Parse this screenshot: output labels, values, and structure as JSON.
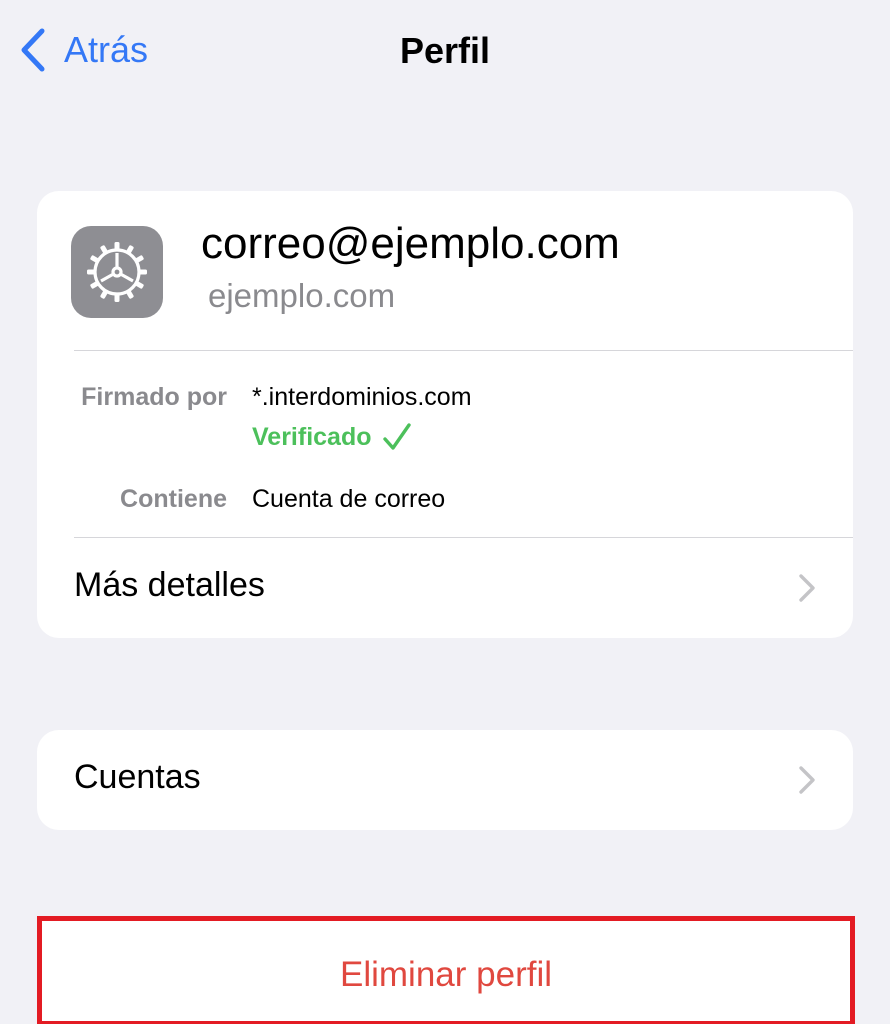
{
  "nav": {
    "back_label": "Atrás",
    "title": "Perfil"
  },
  "profile": {
    "icon": "settings-gear-icon",
    "email": "correo@ejemplo.com",
    "domain": "ejemplo.com",
    "signed_by_label": "Firmado por",
    "signed_by_value": "*.interdominios.com",
    "verified_label": "Verificado",
    "contains_label": "Contiene",
    "contains_value": "Cuenta de correo",
    "more_details_label": "Más detalles"
  },
  "accounts": {
    "label": "Cuentas"
  },
  "delete": {
    "label": "Eliminar perfil"
  },
  "colors": {
    "background": "#f1f1f6",
    "accent": "#3478f6",
    "verified": "#4cc05b",
    "destructive": "#e0483f",
    "highlight_border": "#e31b23",
    "icon_background": "#8e8e93"
  }
}
